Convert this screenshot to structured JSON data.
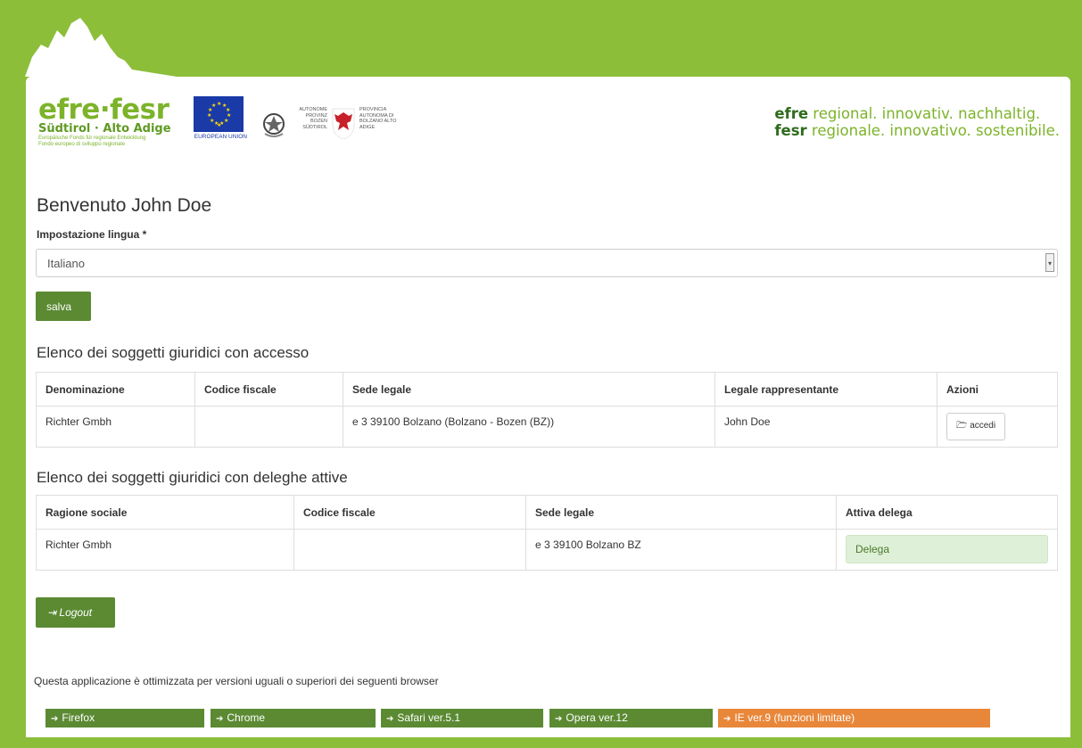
{
  "header": {
    "logo_title": "efre·fesr",
    "logo_sub": "Südtirol · Alto Adige",
    "logo_tiny1": "Europäische Fonds für regionale Entwicklung",
    "logo_tiny2": "Fondo europeo di sviluppo regionale",
    "eu_label": "EUROPEAN UNION",
    "prov_left": "AUTONOME PROVINZ BOZEN SÜDTIROL",
    "prov_right": "PROVINCIA AUTONOMA DI BOLZANO ALTO ADIGE",
    "slogan_de_bold": "efre",
    "slogan_de": " regional. innovativ. nachhaltig.",
    "slogan_it_bold": "fesr",
    "slogan_it": " regionale. innovativo. sostenibile."
  },
  "welcome": "Benvenuto John Doe",
  "language": {
    "label": "Impostazione lingua *",
    "value": "Italiano",
    "save_label": "salva"
  },
  "access_section": {
    "title": "Elenco dei soggetti giuridici con accesso",
    "columns": [
      "Denominazione",
      "Codice fiscale",
      "Sede legale",
      "Legale rappresentante",
      "Azioni"
    ],
    "rows": [
      {
        "denominazione": "Richter Gmbh",
        "codice_fiscale": "",
        "sede_legale": "e 3 39100 Bolzano (Bolzano - Bozen (BZ))",
        "legale_rappresentante": "John Doe",
        "action_label": "accedi"
      }
    ]
  },
  "delegation_section": {
    "title": "Elenco dei soggetti giuridici con deleghe attive",
    "columns": [
      "Ragione sociale",
      "Codice fiscale",
      "Sede legale",
      "Attiva delega"
    ],
    "rows": [
      {
        "ragione_sociale": "Richter Gmbh",
        "codice_fiscale": "",
        "sede_legale": "e 3 39100 Bolzano BZ",
        "action_label": "Delega"
      }
    ]
  },
  "logout_label": "Logout",
  "browser_note": "Questa applicazione è ottimizzata per versioni uguali o superiori dei seguenti browser",
  "browsers": [
    "Firefox",
    "Chrome",
    "Safari ver.5.1",
    "Opera ver.12",
    "IE ver.9 (funzioni limitate)"
  ],
  "colors": {
    "brand_green": "#8cbe3a",
    "button_green": "#5b8a33",
    "ie_orange": "#e8873a",
    "delega_bg": "#dff0d8"
  }
}
